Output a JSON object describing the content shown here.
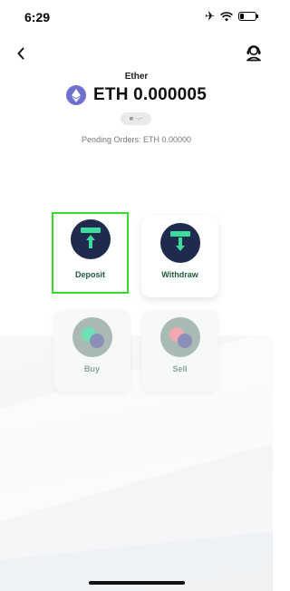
{
  "status_bar": {
    "time": "6:29",
    "icons": [
      "airplane-icon",
      "wifi-icon",
      "battery-icon"
    ]
  },
  "header": {
    "back_icon": "chevron-left-icon",
    "support_icon": "support-agent-icon"
  },
  "asset": {
    "name": "Ether",
    "logo_icon": "ethereum-icon",
    "balance": "ETH 0.000005",
    "fiat_value": "-,--",
    "pending_orders": "Pending Orders: ETH 0.00000"
  },
  "actions": [
    {
      "label": "Deposit",
      "icon": "deposit-icon",
      "enabled": true,
      "highlighted": true
    },
    {
      "label": "Withdraw",
      "icon": "withdraw-icon",
      "enabled": true,
      "highlighted": false
    },
    {
      "label": "Buy",
      "icon": "buy-icon",
      "enabled": false,
      "highlighted": false
    },
    {
      "label": "Sell",
      "icon": "sell-icon",
      "enabled": false,
      "highlighted": false
    }
  ],
  "colors": {
    "accent_green": "#3ddc9b",
    "label_green": "#1f5a3c",
    "navy": "#1f2a4e",
    "highlight_border": "#39d92b",
    "eth_purple": "#6f6fcf"
  }
}
